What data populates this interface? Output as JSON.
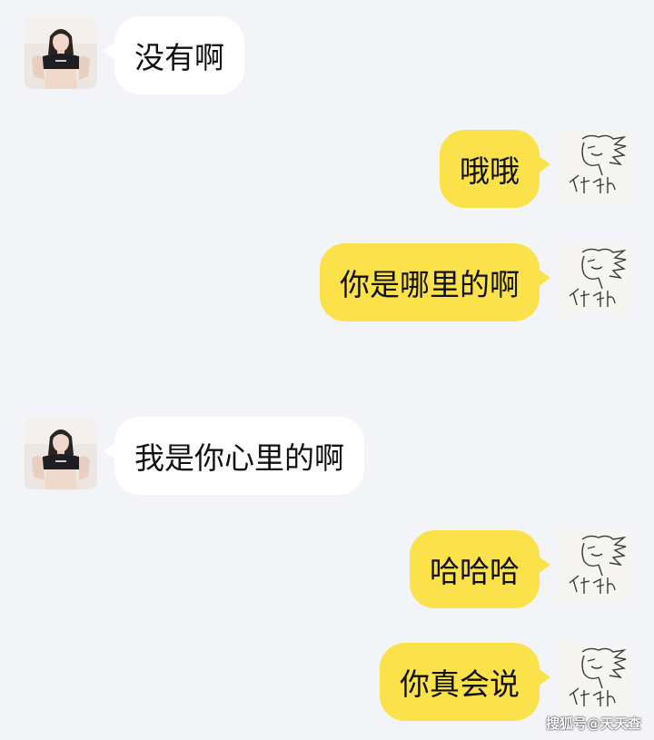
{
  "contact": {
    "avatar_icon": "girl-photo-avatar"
  },
  "me": {
    "avatar_icon": "sketch-drawing-avatar"
  },
  "messages": [
    {
      "sender": "contact",
      "text": "没有啊"
    },
    {
      "sender": "me",
      "text": "哦哦"
    },
    {
      "sender": "me",
      "text": "你是哪里的啊"
    },
    {
      "sender": "contact",
      "text": "我是你心里的啊"
    },
    {
      "sender": "me",
      "text": "哈哈哈"
    },
    {
      "sender": "me",
      "text": "你真会说"
    }
  ],
  "watermark": "搜狐号@天天查",
  "colors": {
    "background": "#f3f4f8",
    "incoming_bubble": "#ffffff",
    "outgoing_bubble": "#fbe14a"
  }
}
